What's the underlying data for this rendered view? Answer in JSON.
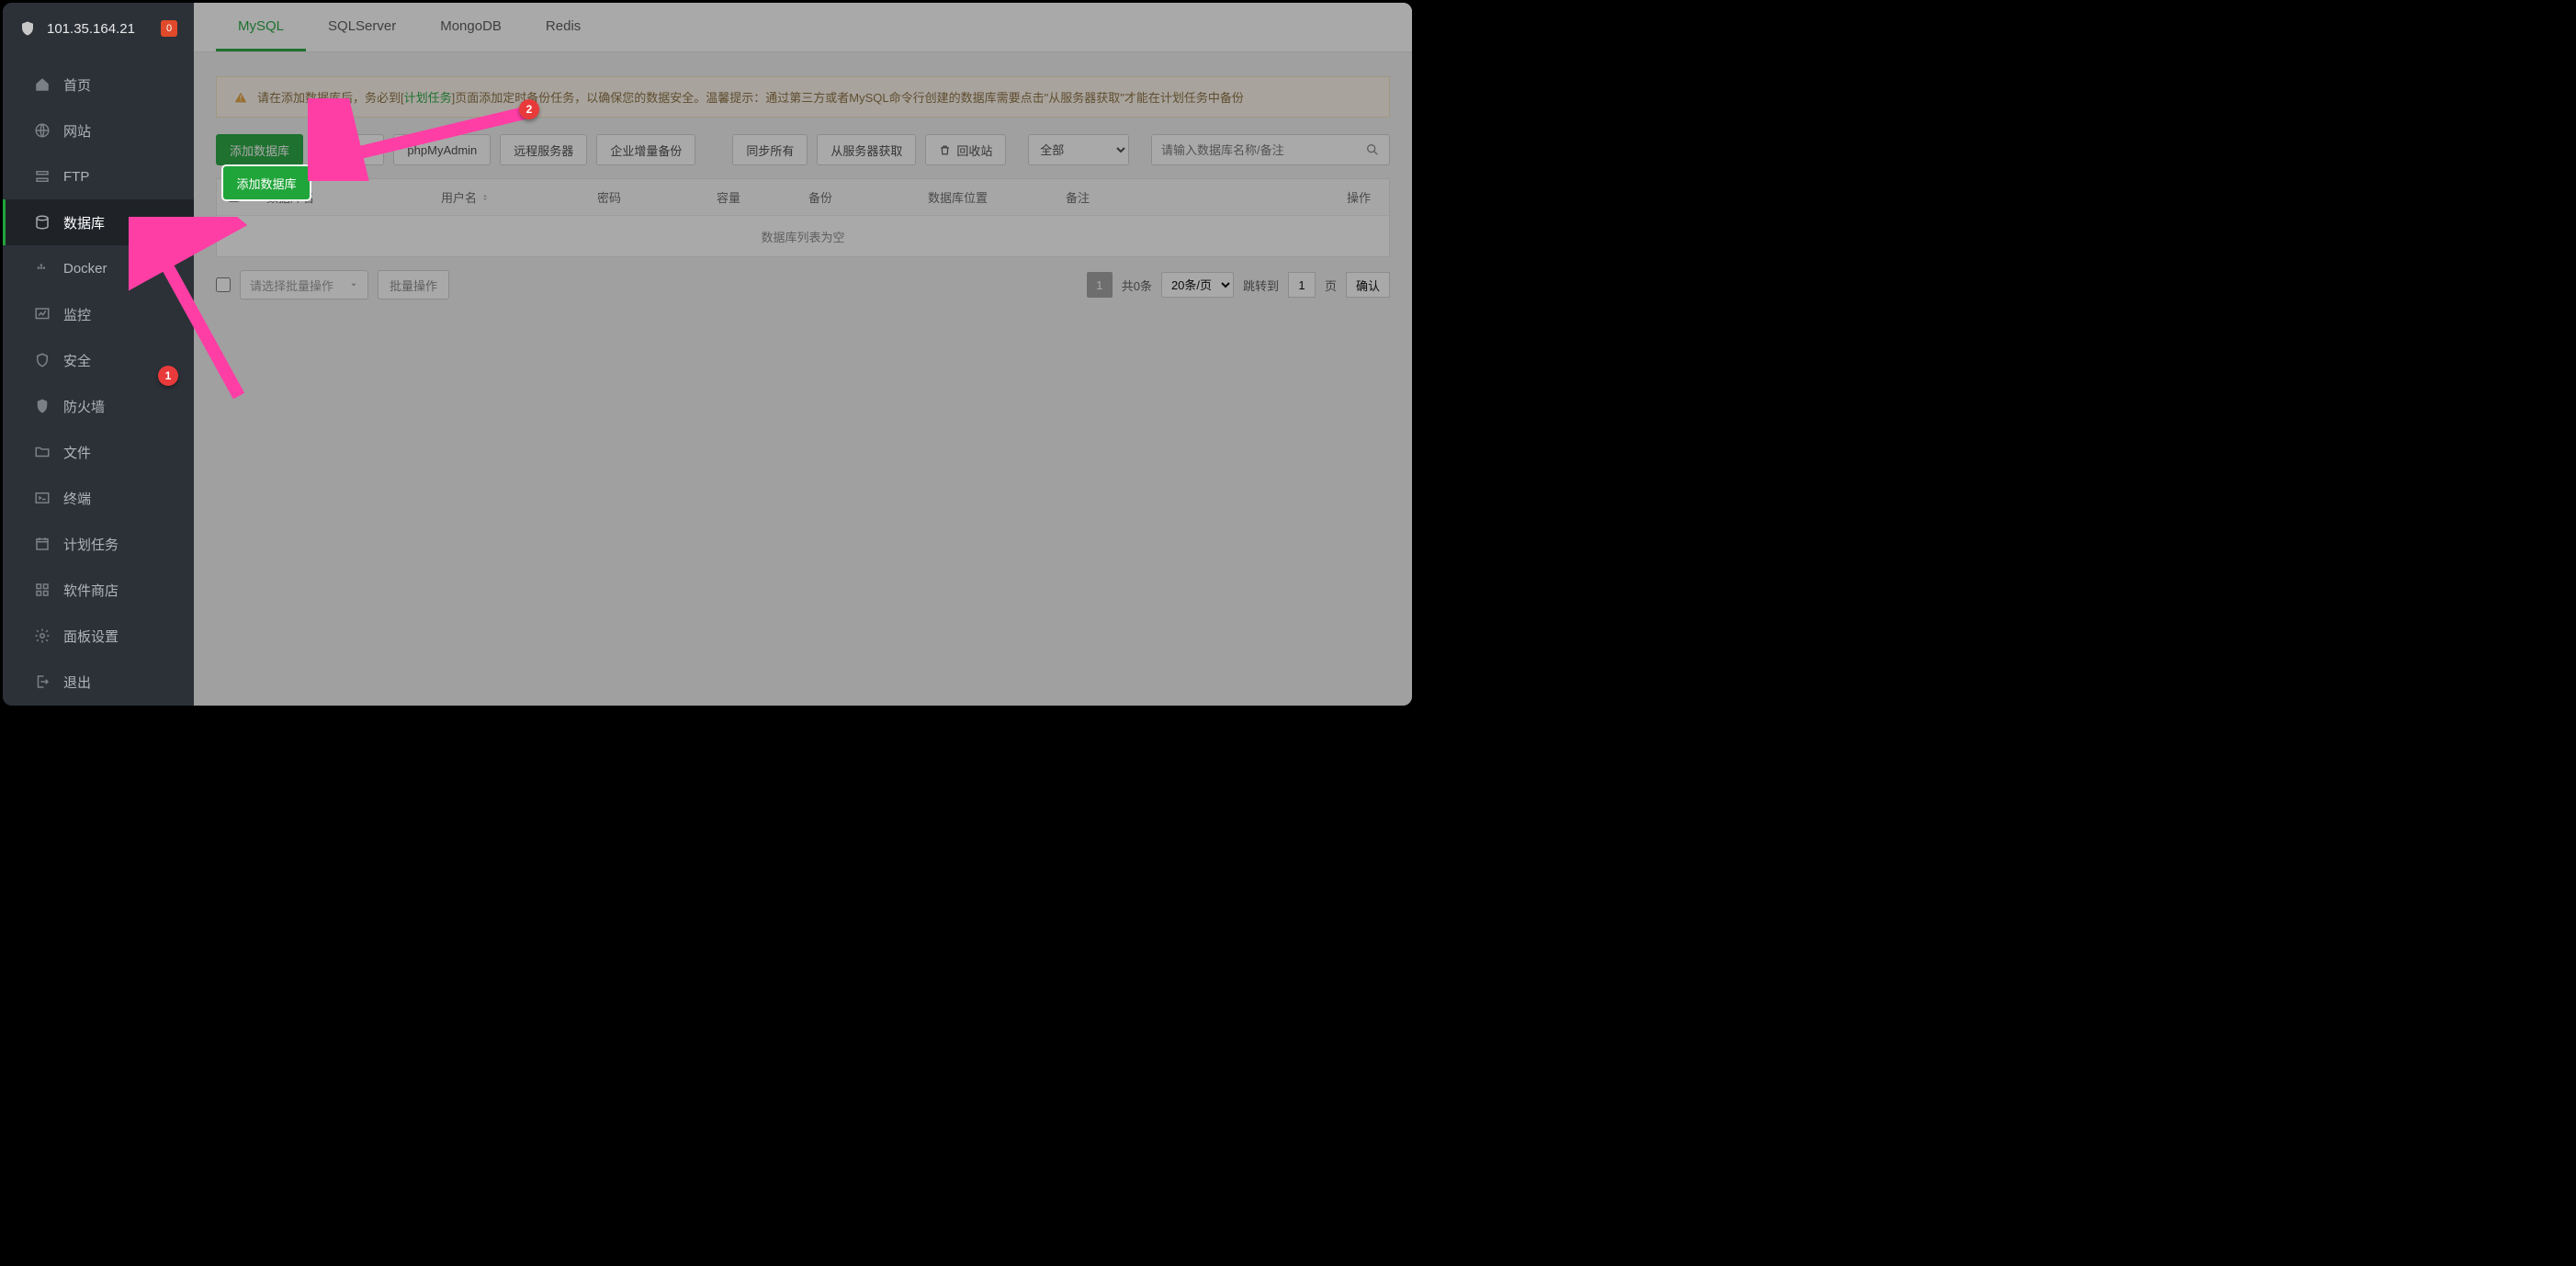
{
  "server_ip": "101.35.164.21",
  "badge_count": "0",
  "sidebar": {
    "items": [
      {
        "label": "首页",
        "icon": "home-icon"
      },
      {
        "label": "网站",
        "icon": "globe-icon"
      },
      {
        "label": "FTP",
        "icon": "ftp-icon"
      },
      {
        "label": "数据库",
        "icon": "database-icon",
        "active": true
      },
      {
        "label": "Docker",
        "icon": "docker-icon"
      },
      {
        "label": "监控",
        "icon": "monitor-icon"
      },
      {
        "label": "安全",
        "icon": "shield-icon"
      },
      {
        "label": "防火墙",
        "icon": "firewall-icon"
      },
      {
        "label": "文件",
        "icon": "folder-icon"
      },
      {
        "label": "终端",
        "icon": "terminal-icon"
      },
      {
        "label": "计划任务",
        "icon": "cron-icon"
      },
      {
        "label": "软件商店",
        "icon": "store-icon"
      },
      {
        "label": "面板设置",
        "icon": "settings-icon"
      },
      {
        "label": "退出",
        "icon": "logout-icon"
      }
    ]
  },
  "tabs": [
    {
      "label": "MySQL",
      "active": true
    },
    {
      "label": "SQLServer"
    },
    {
      "label": "MongoDB"
    },
    {
      "label": "Redis"
    }
  ],
  "alert": {
    "text_before": "请在添加数据库后，务必到[",
    "link_text": "计划任务",
    "text_after": "]页面添加定时备份任务，以确保您的数据安全。温馨提示：通过第三方或者MySQL命令行创建的数据库需要点击\"从服务器获取\"才能在计划任务中备份"
  },
  "toolbar": {
    "add_db": "添加数据库",
    "root_pwd": "root密码",
    "phpmyadmin": "phpMyAdmin",
    "remote_server": "远程服务器",
    "enterprise_backup": "企业增量备份",
    "sync_all": "同步所有",
    "fetch_from_server": "从服务器获取",
    "recycle": "回收站",
    "filter_all": "全部",
    "search_placeholder": "请输入数据库名称/备注"
  },
  "table": {
    "headers": {
      "name": "数据库名",
      "user": "用户名",
      "pwd": "密码",
      "size": "容量",
      "backup": "备份",
      "location": "数据库位置",
      "note": "备注",
      "ops": "操作"
    },
    "empty_text": "数据库列表为空"
  },
  "footer": {
    "batch_placeholder": "请选择批量操作",
    "batch_btn": "批量操作",
    "current_page": "1",
    "total_text": "共0条",
    "per_page": "20条/页",
    "jump_label": "跳转到",
    "jump_value": "1",
    "page_unit": "页",
    "confirm": "确认"
  },
  "callouts": {
    "one": "1",
    "two": "2"
  }
}
